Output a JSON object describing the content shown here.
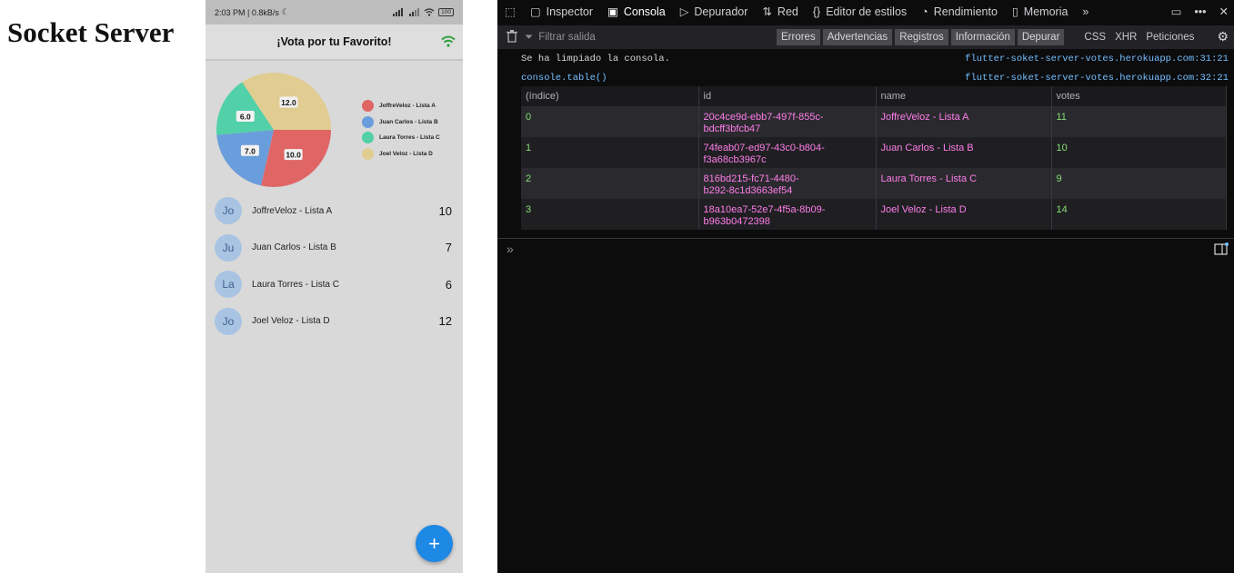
{
  "page": {
    "title": "Socket Server"
  },
  "phone": {
    "status": {
      "time": "2:03 PM | 0.8kB/s",
      "battery": "100"
    },
    "app_title": "¡Vota por tu Favorito!",
    "chart_data": {
      "type": "pie",
      "values": [
        10.0,
        7.0,
        6.0,
        12.0
      ],
      "labels": [
        "10.0",
        "7.0",
        "6.0",
        "12.0"
      ],
      "legend": [
        "JoffreVeloz - Lista A",
        "Juan Carlos - Lista B",
        "Laura Torres - Lista C",
        "Joel Veloz - Lista D"
      ],
      "colors": [
        "#e06666",
        "#6a9ddb",
        "#52d0a8",
        "#e1cc92"
      ]
    },
    "bands": [
      {
        "initials": "Jo",
        "name": "JoffreVeloz - Lista A",
        "votes": "10"
      },
      {
        "initials": "Ju",
        "name": "Juan Carlos - Lista B",
        "votes": "7"
      },
      {
        "initials": "La",
        "name": "Laura Torres - Lista C",
        "votes": "6"
      },
      {
        "initials": "Jo",
        "name": "Joel Veloz - Lista D",
        "votes": "12"
      }
    ],
    "fab_label": "+"
  },
  "devtools": {
    "tabs": [
      {
        "icon": "pick-element-icon",
        "label": ""
      },
      {
        "icon": "inspector-icon",
        "label": "Inspector"
      },
      {
        "icon": "console-icon",
        "label": "Consola"
      },
      {
        "icon": "debugger-icon",
        "label": "Depurador"
      },
      {
        "icon": "network-icon",
        "label": "Red"
      },
      {
        "icon": "style-editor-icon",
        "label": "Editor de estilos"
      },
      {
        "icon": "performance-icon",
        "label": "Rendimiento"
      },
      {
        "icon": "memory-icon",
        "label": "Memoria"
      }
    ],
    "filter_placeholder": "Filtrar salida",
    "filter_buttons": [
      "Errores",
      "Advertencias",
      "Registros",
      "Información",
      "Depurar"
    ],
    "filter_plain": [
      "CSS",
      "XHR",
      "Peticiones"
    ],
    "console_lines": [
      {
        "msg": "Se ha limpiado la consola.",
        "src": "flutter-soket-server-votes.herokuapp.com:31:21"
      },
      {
        "msg": "console.table()",
        "src": "flutter-soket-server-votes.herokuapp.com:32:21"
      }
    ],
    "table": {
      "headers": [
        "(índice)",
        "id",
        "name",
        "votes"
      ],
      "rows": [
        {
          "idx": "0",
          "id_1": "20c4ce9d-ebb7-497f-855c-",
          "id_2": "bdcff3bfcb47",
          "name": "JoffreVeloz - Lista A",
          "votes": "11"
        },
        {
          "idx": "1",
          "id_1": "74feab07-ed97-43c0-b804-",
          "id_2": "f3a68cb3967c",
          "name": "Juan Carlos - Lista B",
          "votes": "10"
        },
        {
          "idx": "2",
          "id_1": "816bd215-fc71-4480-",
          "id_2": "b292-8c1d3663ef54",
          "name": "Laura Torres - Lista C",
          "votes": "9"
        },
        {
          "idx": "3",
          "id_1": "18a10ea7-52e7-4f5a-8b09-",
          "id_2": "b963b0472398",
          "name": "Joel Veloz - Lista D",
          "votes": "14"
        }
      ]
    },
    "prompt": "»"
  }
}
